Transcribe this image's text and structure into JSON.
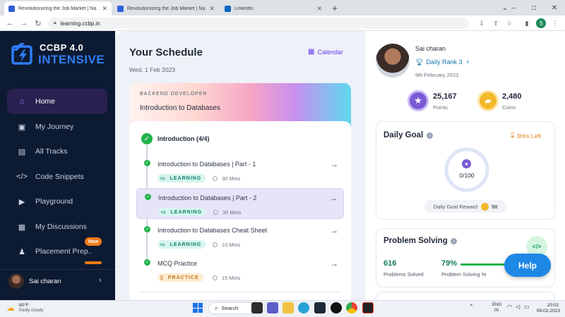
{
  "browser": {
    "tabs": [
      {
        "title": "Revolutionizing the Job Market | Na",
        "active": true
      },
      {
        "title": "Revolutionizing the Job Market | Na",
        "active": false
      },
      {
        "title": "LinkedIn",
        "active": false
      }
    ],
    "new_tab": "+",
    "url": "learning.ccbp.in",
    "profile_initial": "S"
  },
  "sidebar": {
    "logo_line1": "CCBP 4.0",
    "logo_line2": "INTENSIVE",
    "items": [
      {
        "label": "Home",
        "icon": "home-icon",
        "active": true
      },
      {
        "label": "My Journey",
        "icon": "journey-icon"
      },
      {
        "label": "All Tracks",
        "icon": "tracks-icon"
      },
      {
        "label": "Code Snippets",
        "icon": "code-icon"
      },
      {
        "label": "Playground",
        "icon": "terminal-icon"
      },
      {
        "label": "My Discussions",
        "icon": "discussions-icon"
      },
      {
        "label": "Placement Prep..",
        "icon": "placement-icon",
        "badge": "New"
      }
    ],
    "user_name": "Sai charan"
  },
  "schedule": {
    "title": "Your Schedule",
    "calendar_label": "Calendar",
    "date": "Wed, 1 Feb 2023",
    "track_label": "BACKEND DEVELOPER",
    "course_title": "Introduction to Databases",
    "section_title": "Introduction (4/4)",
    "lessons": [
      {
        "title": "Introduction to Databases | Part - 1",
        "tag": "LEARNING",
        "duration": "30 Mins"
      },
      {
        "title": "Introduction to Databases | Part - 2",
        "tag": "LEARNING",
        "duration": "30 Mins"
      },
      {
        "title": "Introduction to Databases Cheat Sheet",
        "tag": "LEARNING",
        "duration": "10 Mins"
      },
      {
        "title": "MCQ Practice",
        "tag": "PRACTICE",
        "duration": "15 Mins"
      }
    ]
  },
  "profile": {
    "name": "Sai charan",
    "rank": "Daily Rank 3",
    "date": "9th February 2023",
    "points_value": "25,167",
    "points_label": "Points",
    "coins_value": "2,480",
    "coins_label": "Coins"
  },
  "daily_goal": {
    "title": "Daily Goal",
    "time_left": "3Hrs Left",
    "progress_text": "0/100",
    "progress_fraction": 0,
    "reward_label": "Daily Goal Reward",
    "reward_value": "50"
  },
  "problem_solving": {
    "title": "Problem Solving",
    "solved_value": "616",
    "solved_label": "Problems Solved",
    "percent_value": "79%",
    "percent_label": "Problem Solving %",
    "percent_fraction": 0.79
  },
  "help_label": "Help",
  "taskbar": {
    "weather_temp": "80°F",
    "weather_desc": "Partly cloudy",
    "search_label": "Search",
    "lang_line1": "ENG",
    "lang_line2": "IN",
    "time": "20:03",
    "date": "09-02-2023"
  },
  "colors": {
    "sidebar_bg": "#0c1a32",
    "accent_purple": "#6b3cf6",
    "help_blue": "#1e88e5",
    "learning_green": "#10806a",
    "practice_orange": "#c0711b",
    "check_green": "#22b24c"
  }
}
